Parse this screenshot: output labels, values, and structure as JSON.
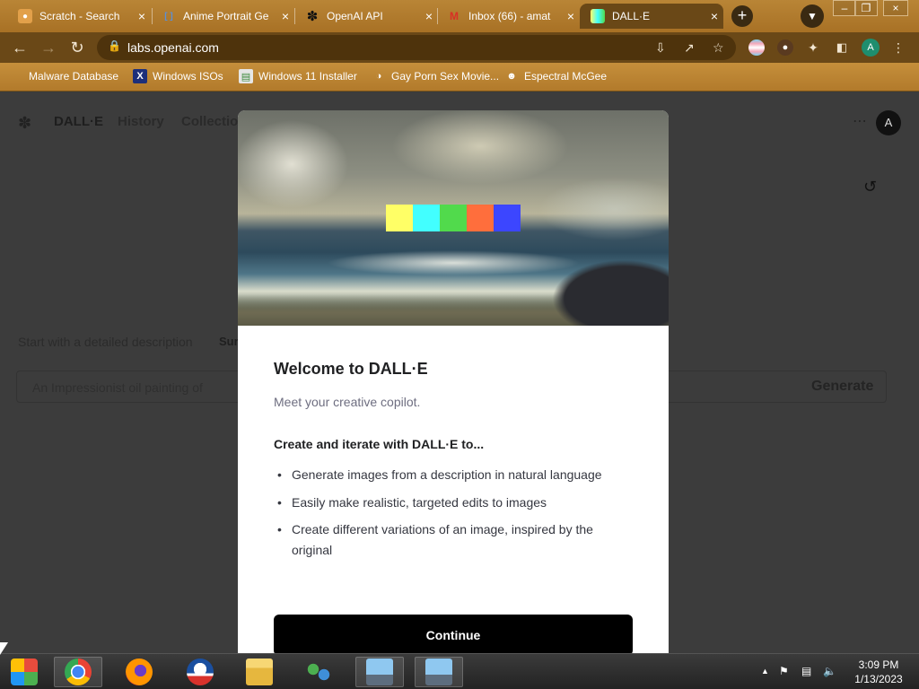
{
  "browser": {
    "tabs": [
      {
        "title": "Scratch - Search",
        "icon": "search-favicon",
        "icon_color": "#e2a04a"
      },
      {
        "title": "Anime Portrait Ge",
        "icon": "brackets-favicon",
        "icon_color": "#5b8fd6"
      },
      {
        "title": "OpenAI API",
        "icon": "openai-favicon",
        "icon_color": "#111111"
      },
      {
        "title": "Inbox (66) - amat",
        "icon": "gmail-favicon",
        "icon_color": "#d93025"
      },
      {
        "title": "DALL·E",
        "icon": "dalle-favicon",
        "icon_color": "#7fc36b"
      }
    ],
    "url": "labs.openai.com",
    "bookmarks": [
      {
        "label": "Malware Database",
        "icon": "folder-icon"
      },
      {
        "label": "Windows ISOs",
        "icon": "x-logo-icon"
      },
      {
        "label": "Windows 11 Installer",
        "icon": "image-icon"
      },
      {
        "label": "Gay Porn Sex Movie...",
        "icon": "site-icon"
      },
      {
        "label": "Espectral McGee",
        "icon": "avatar-icon"
      }
    ],
    "profile_initial": "A"
  },
  "page": {
    "brand": "DALL·E",
    "nav": [
      "History",
      "Collectio"
    ],
    "avatar_initial": "A",
    "start_text": "Start with a detailed description",
    "surprise_label": "Sur",
    "prompt_placeholder": "An Impressionist oil painting of",
    "generate_label": "Generate"
  },
  "modal": {
    "title": "Welcome to DALL·E",
    "subtitle": "Meet your creative copilot.",
    "lead": "Create and iterate with DALL·E to...",
    "bullets": [
      "Generate images from a description in natural language",
      "Easily make realistic, targeted edits to images",
      "Create different variations of an image, inspired by the original"
    ],
    "continue_label": "Continue",
    "swatch_colors": [
      "#ffff66",
      "#42ffff",
      "#51da4c",
      "#ff6e3c",
      "#3c46ff"
    ]
  },
  "taskbar": {
    "apps": [
      "start-button",
      "chrome-icon",
      "firefox-icon",
      "obama-icon",
      "file-explorer-icon",
      "network-icon",
      "remote-desktop-icon",
      "remote-desktop-icon"
    ],
    "time": "3:09 PM",
    "date": "1/13/2023"
  }
}
